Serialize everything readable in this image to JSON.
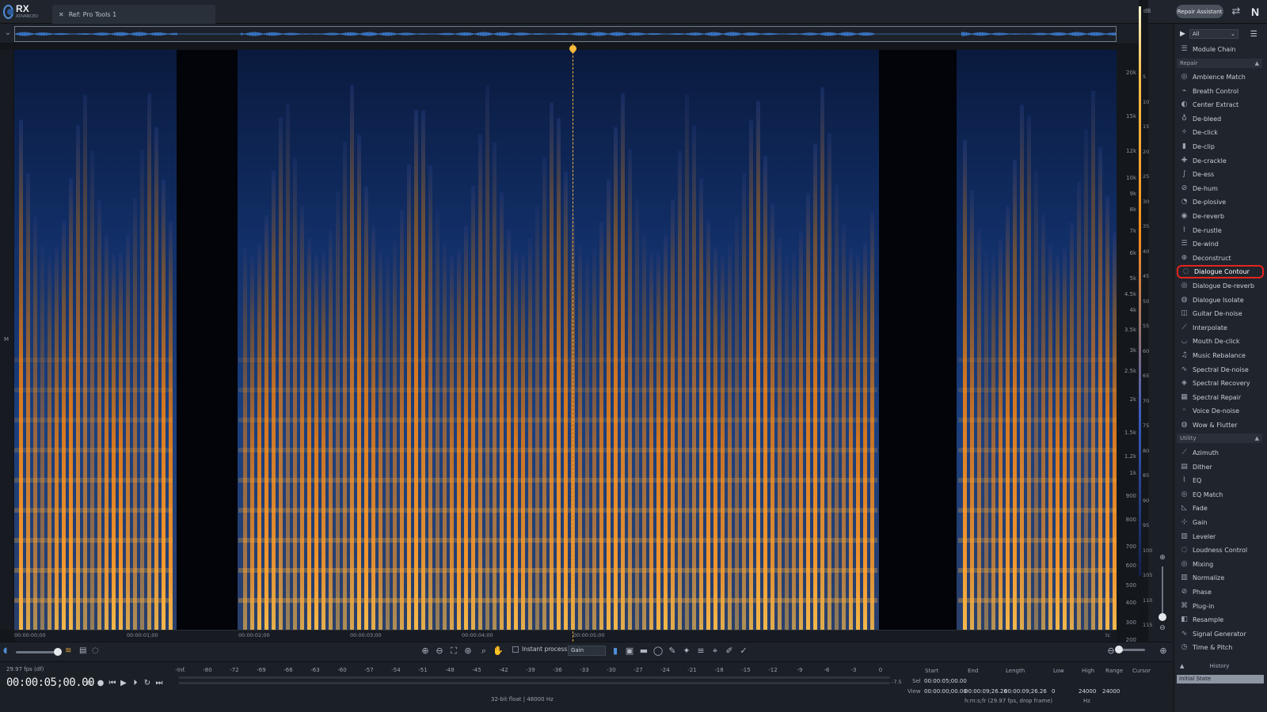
{
  "app": {
    "logo": "RX",
    "logo_sub": "ADVANCED",
    "tab_title": "Ref: Pro Tools 1",
    "repair_assistant": "Repair Assistant"
  },
  "panel": {
    "filter": "All",
    "module_chain": "Module Chain",
    "repair_header": "Repair",
    "utility_header": "Utility",
    "repair_modules": [
      "Ambience Match",
      "Breath Control",
      "Center Extract",
      "De-bleed",
      "De-click",
      "De-clip",
      "De-crackle",
      "De-ess",
      "De-hum",
      "De-plosive",
      "De-reverb",
      "De-rustle",
      "De-wind",
      "Deconstruct",
      "Dialogue Contour",
      "Dialogue De-reverb",
      "Dialogue Isolate",
      "Guitar De-noise",
      "Interpolate",
      "Mouth De-click",
      "Music Rebalance",
      "Spectral De-noise",
      "Spectral Recovery",
      "Spectral Repair",
      "Voice De-noise",
      "Wow & Flutter"
    ],
    "utility_modules": [
      "Azimuth",
      "Dither",
      "EQ",
      "EQ Match",
      "Fade",
      "Gain",
      "Leveler",
      "Loudness Control",
      "Mixing",
      "Normalize",
      "Phase",
      "Plug-in",
      "Resample",
      "Signal Generator",
      "Time & Pitch"
    ],
    "highlighted_module": "Dialogue Contour",
    "history_title": "History",
    "history_state": "Initial State"
  },
  "spectrogram": {
    "channel_label": "M",
    "freq_ticks": [
      "20k",
      "15k",
      "12k",
      "10k",
      "9k",
      "8k",
      "7k",
      "6k",
      "5k",
      "4.5k",
      "4k",
      "3.5k",
      "3k",
      "2.5k",
      "2k",
      "1.5k",
      "1.2k",
      "1k",
      "900",
      "800",
      "700",
      "600",
      "500",
      "400",
      "300",
      "200",
      "100",
      "Hz"
    ],
    "db_label": "dB",
    "db_ticks": [
      "5",
      "10",
      "15",
      "20",
      "25",
      "30",
      "35",
      "40",
      "45",
      "50",
      "55",
      "60",
      "65",
      "70",
      "75",
      "80",
      "85",
      "90",
      "95",
      "100",
      "105",
      "110",
      "115"
    ],
    "time_ticks": [
      "00:00:00;00",
      "00:00:01;00",
      "00:00:02;00",
      "00:00:03;00",
      "00:00:04;00",
      "00:00:05;00"
    ],
    "time_unit": "tc",
    "highlight_color": "#e5241c"
  },
  "toolbar": {
    "instant_process": "Instant process",
    "process_mode": "Gain"
  },
  "transport": {
    "fps": "29.97 fps (df)",
    "timecode": "00:00:05;00.00",
    "meter_ticks": [
      "-Inf.",
      "-80",
      "-72",
      "-69",
      "-66",
      "-63",
      "-60",
      "-57",
      "-54",
      "-51",
      "-48",
      "-45",
      "-42",
      "-39",
      "-36",
      "-33",
      "-30",
      "-27",
      "-24",
      "-21",
      "-18",
      "-15",
      "-12",
      "-9",
      "-6",
      "-3",
      "0"
    ],
    "meter_peak": "-7.5",
    "format": "32-bit float | 48000 Hz"
  },
  "selection": {
    "headers": [
      "Start",
      "End",
      "Length",
      "Low",
      "High",
      "Range",
      "Cursor"
    ],
    "sel_label": "Sel",
    "view_label": "View",
    "sel_start": "00:00:05;00.00",
    "view_start": "00:00:00;00.00",
    "view_end": "00:00:09;26.26",
    "view_length": "00:00:09;26.26",
    "low": "0",
    "high": "24000",
    "range": "24000",
    "hz_unit": "Hz",
    "time_format": "h:m:s;fr (29.97 fps, drop frame)"
  }
}
